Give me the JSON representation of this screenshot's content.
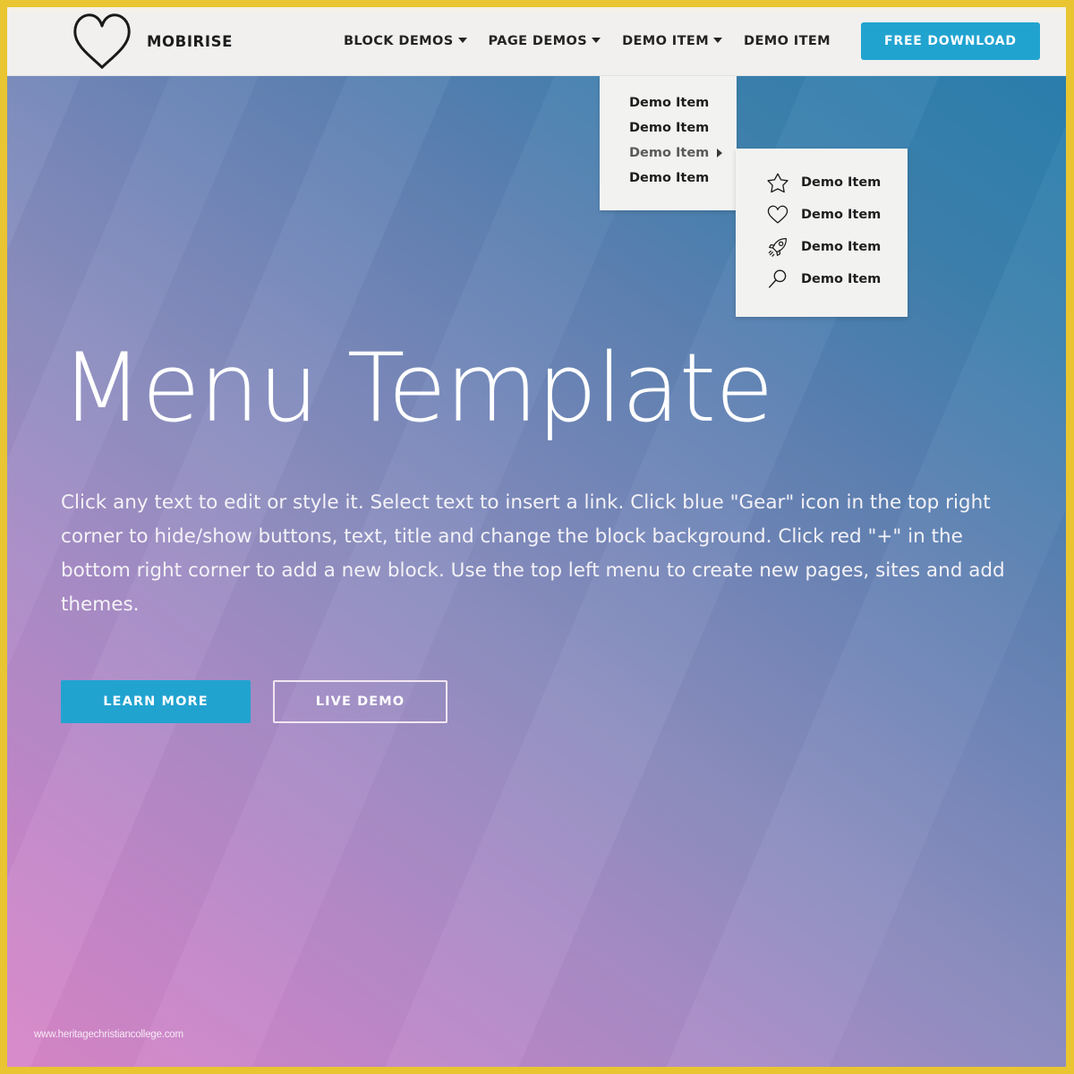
{
  "frame": {
    "border_color": "#E8C531"
  },
  "header": {
    "background": "#F1F0EF",
    "brand": {
      "logo_icon": "heart-icon",
      "name": "MOBIRISE"
    },
    "nav_items": [
      {
        "label": "BLOCK DEMOS",
        "has_caret": true
      },
      {
        "label": "PAGE DEMOS",
        "has_caret": true
      },
      {
        "label": "DEMO ITEM",
        "has_caret": true
      },
      {
        "label": "DEMO ITEM",
        "has_caret": false
      }
    ],
    "cta": {
      "label": "FREE DOWNLOAD",
      "color": "#21A3D0"
    }
  },
  "dropdown": {
    "items": [
      {
        "label": "Demo Item",
        "has_submenu": false
      },
      {
        "label": "Demo Item",
        "has_submenu": false
      },
      {
        "label": "Demo Item",
        "has_submenu": true
      },
      {
        "label": "Demo Item",
        "has_submenu": false
      }
    ],
    "submenu": {
      "items": [
        {
          "label": "Demo Item",
          "icon": "star-icon"
        },
        {
          "label": "Demo Item",
          "icon": "heart-icon"
        },
        {
          "label": "Demo Item",
          "icon": "rocket-icon"
        },
        {
          "label": "Demo Item",
          "icon": "magnifier-icon"
        }
      ]
    }
  },
  "hero": {
    "title": "Menu Template",
    "text": "Click any text to edit or style it. Select text to insert a link. Click blue \"Gear\" icon in the top right corner to hide/show buttons, text, title and change the block background. Click red \"+\" in the bottom right corner to add a new block. Use the top left menu to create new pages, sites and add themes.",
    "primary_button": "LEARN MORE",
    "secondary_button": "LIVE DEMO",
    "gradient_start": "#D886C8",
    "gradient_end": "#2B7FAE"
  },
  "watermark": {
    "text": "www.heritagechristiancollege.com"
  }
}
